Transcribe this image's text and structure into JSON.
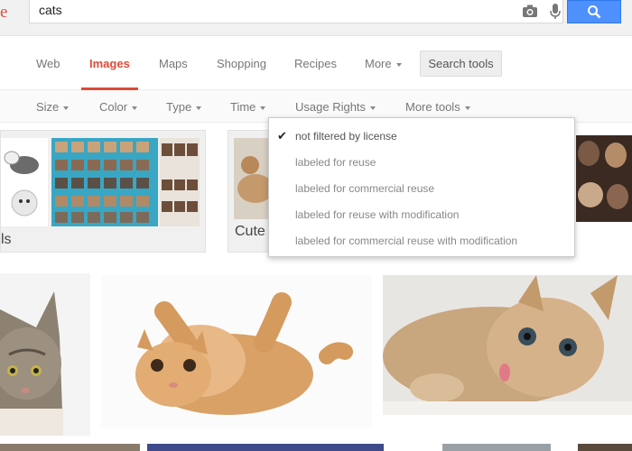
{
  "header": {
    "logo_fragment": "e",
    "search_query": "cats"
  },
  "tabs": [
    {
      "label": "Web",
      "active": false
    },
    {
      "label": "Images",
      "active": true
    },
    {
      "label": "Maps",
      "active": false
    },
    {
      "label": "Shopping",
      "active": false
    },
    {
      "label": "Recipes",
      "active": false
    },
    {
      "label": "More",
      "active": false
    }
  ],
  "search_tools_label": "Search tools",
  "tools": [
    {
      "label": "Size"
    },
    {
      "label": "Color"
    },
    {
      "label": "Type"
    },
    {
      "label": "Time"
    },
    {
      "label": "Usage Rights"
    },
    {
      "label": "More tools"
    }
  ],
  "usage_rights_menu": {
    "items": [
      {
        "label": "not filtered by license",
        "checked": true
      },
      {
        "label": "labeled for reuse",
        "checked": false
      },
      {
        "label": "labeled for commercial reuse",
        "checked": false
      },
      {
        "label": "labeled for reuse with modification",
        "checked": false
      },
      {
        "label": "labeled for commercial reuse with modification",
        "checked": false
      }
    ]
  },
  "related": {
    "card1_label": "ls",
    "card2_label": "Cute"
  },
  "colors": {
    "accent_red": "#dd4b39",
    "search_blue": "#4d90fe"
  }
}
